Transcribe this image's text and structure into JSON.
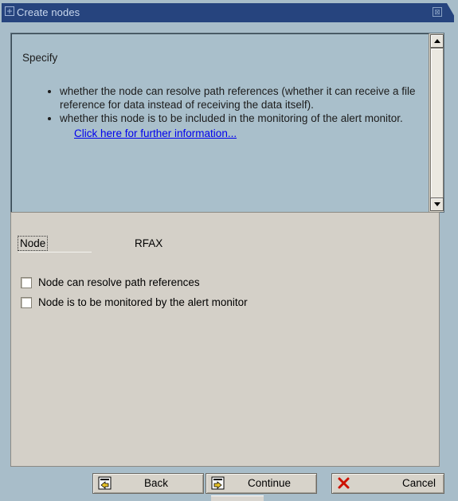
{
  "window": {
    "title": "Create nodes",
    "title_icon": "dialog-icon",
    "close_glyph": "⊠"
  },
  "info": {
    "heading": "Specify",
    "bullets": [
      "whether the node can resolve path references (whether it can receive a file reference for data instead of receiving the data itself).",
      "whether this node is to be included in the monitoring of the alert monitor."
    ],
    "link_text": "Click here for further information..."
  },
  "form": {
    "node_label": "Node",
    "node_value": "RFAX",
    "checkboxes": [
      {
        "label": "Node can resolve path references",
        "checked": false
      },
      {
        "label": "Node is to be monitored by the alert monitor",
        "checked": false
      }
    ]
  },
  "buttons": {
    "back": "Back",
    "continue": "Continue",
    "cancel": "Cancel"
  },
  "colors": {
    "title_bar": "#26447e",
    "window_bg": "#a8bdc9",
    "link": "#0000ee",
    "cancel_icon": "#cc1100"
  }
}
